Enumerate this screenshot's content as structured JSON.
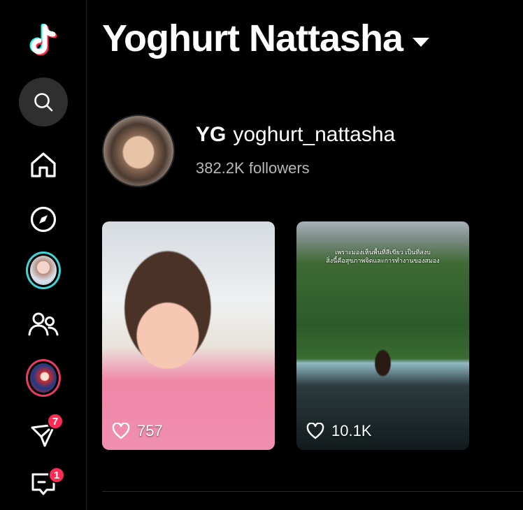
{
  "sidebar": {
    "items": [
      {
        "name": "logo",
        "icon": "tiktok-logo-icon"
      },
      {
        "name": "search",
        "icon": "search-icon"
      },
      {
        "name": "home",
        "icon": "home-icon"
      },
      {
        "name": "explore",
        "icon": "compass-icon"
      },
      {
        "name": "live-story",
        "icon": "avatar"
      },
      {
        "name": "friends",
        "icon": "friends-icon"
      },
      {
        "name": "profile",
        "icon": "avatar"
      },
      {
        "name": "inbox",
        "icon": "paper-plane-icon",
        "badge": "7"
      },
      {
        "name": "messages",
        "icon": "message-icon",
        "badge": "1"
      }
    ]
  },
  "header": {
    "title": "Yoghurt Nattasha"
  },
  "profile": {
    "display_name": "YG",
    "handle": "yoghurt_nattasha",
    "followers": "382.2K followers"
  },
  "videos": [
    {
      "likes": "757"
    },
    {
      "likes": "10.1K",
      "overlay_text": "เพราะมองเห็นพื้นที่สีเขียว เป็นที่สงบ\nสิ่งนี้คือสุขภาพจิตและการทำงานของสมอง"
    }
  ],
  "colors": {
    "background": "#000000",
    "badge": "#fe2c55",
    "search_bg": "#2f2f2f",
    "story_ring_cyan": "#3fd5d7",
    "story_ring_pink": "#e63b63"
  }
}
